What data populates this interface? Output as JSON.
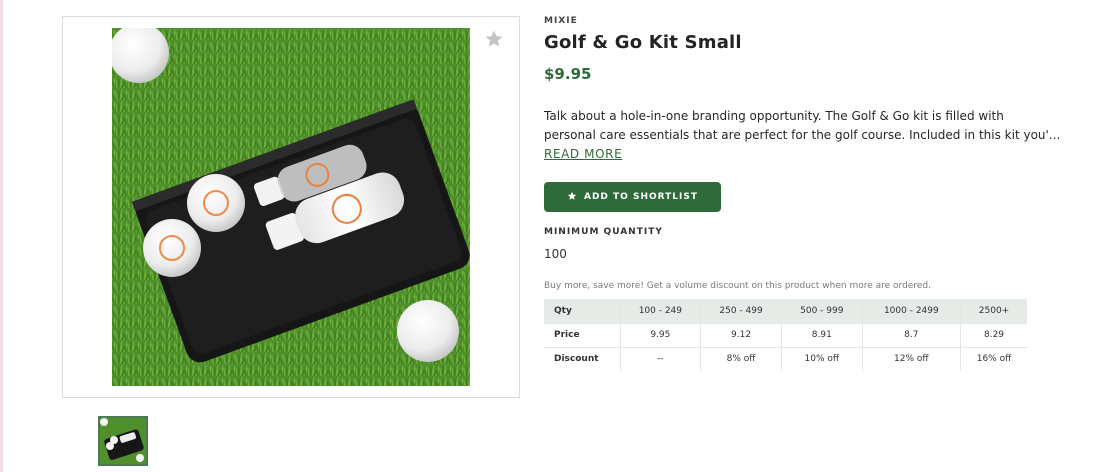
{
  "product": {
    "brand": "MIXIE",
    "title": "Golf & Go Kit Small",
    "price": "$9.95",
    "description_line1": "Talk about a hole-in-one branding opportunity. The Golf & Go kit is filled with",
    "description_line2": "personal care essentials that are perfect for the golf course. Included in this kit you'...",
    "read_more_label": "READ MORE",
    "shortlist_label": "ADD TO SHORTLIST",
    "min_qty_label": "MINIMUM QUANTITY",
    "min_qty_value": "100",
    "volume_note": "Buy more, save more! Get a volume discount on this product when more are ordered."
  },
  "tiers": {
    "header": [
      "Qty",
      "100 - 249",
      "250 - 499",
      "500 - 999",
      "1000 - 2499",
      "2500+"
    ],
    "price_row": [
      "Price",
      "9.95",
      "9.12",
      "8.91",
      "8.7",
      "8.29"
    ],
    "discount_row": [
      "Discount",
      "--",
      "8% off",
      "10% off",
      "12% off",
      "16% off"
    ]
  },
  "icons": {
    "favorite": "star-outline-icon",
    "shortlist": "star-icon"
  },
  "colors": {
    "accent": "#2f6b3a",
    "table_header_bg": "#e6ebe7",
    "grass": "#4a8a2a"
  }
}
